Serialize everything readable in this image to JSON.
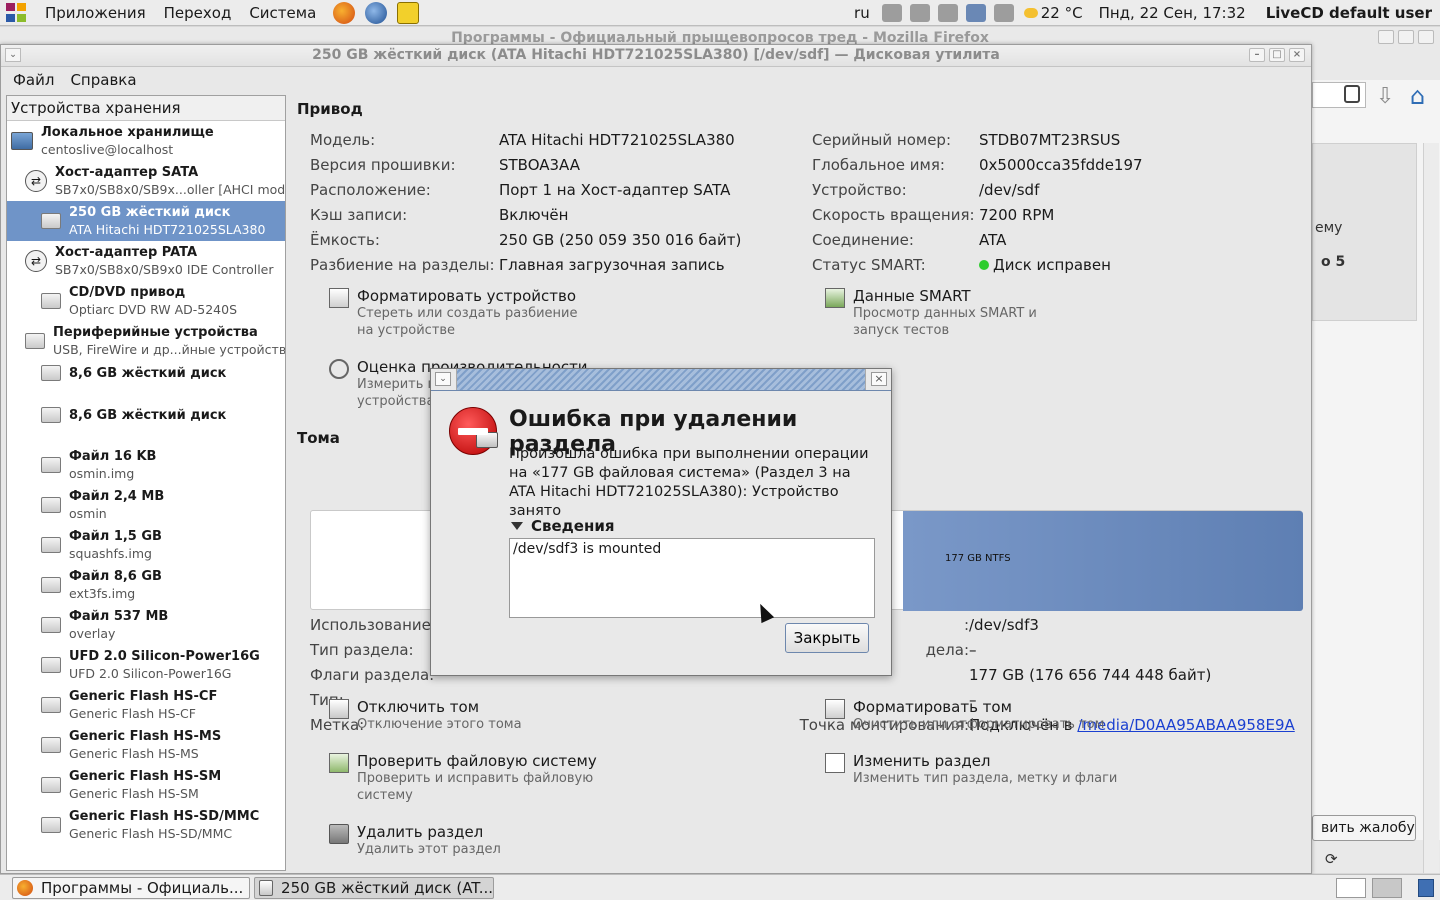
{
  "top_panel": {
    "menus": [
      "Приложения",
      "Переход",
      "Система"
    ],
    "lang": "ru",
    "weather": "22 °C",
    "datetime": "Пнд, 22 Сен, 17:32",
    "user": "LiveCD default user"
  },
  "firefox": {
    "title": "Программы - Официальный прыщевопросов тред - Mozilla Firefox",
    "partial_text1": "ему",
    "partial_text2": "о 5",
    "complaint_button": "вить жалобу"
  },
  "window": {
    "title": "250 GB жёсткий диск (ATA Hitachi HDT721025SLA380) [/dev/sdf] — Дисковая утилита",
    "menu": [
      "Файл",
      "Справка"
    ]
  },
  "sidebar": {
    "header": "Устройства хранения",
    "items": [
      {
        "title": "Локальное хранилище",
        "sub": "centoslive@localhost",
        "icon": "laptop-icon",
        "indent": 0
      },
      {
        "title": "Хост-адаптер SATA",
        "sub": "SB7x0/SB8x0/SB9x...oller [AHCI mode]",
        "icon": "host-adapter-icon",
        "indent": 1
      },
      {
        "title": "250 GB жёсткий диск",
        "sub": "ATA Hitachi HDT721025SLA380",
        "icon": "hard-disk-icon",
        "indent": 2,
        "selected": true
      },
      {
        "title": "Хост-адаптер PATA",
        "sub": "SB7x0/SB8x0/SB9x0 IDE Controller",
        "icon": "host-adapter-icon",
        "indent": 1
      },
      {
        "title": "CD/DVD привод",
        "sub": "Optiarc DVD RW AD-5240S",
        "icon": "optical-drive-icon",
        "indent": 2
      },
      {
        "title": "Периферийные устройства",
        "sub": "USB, FireWire и др...йные устройства",
        "icon": "usb-icon",
        "indent": 1
      },
      {
        "title": "8,6 GB жёсткий диск",
        "sub": "",
        "icon": "hard-disk-icon",
        "indent": 2
      },
      {
        "title": "8,6 GB жёсткий диск",
        "sub": "",
        "icon": "hard-disk-icon",
        "indent": 2
      },
      {
        "title": "Файл 16 KB",
        "sub": "osmin.img",
        "icon": "hard-disk-icon",
        "indent": 2
      },
      {
        "title": "Файл 2,4 MB",
        "sub": "osmin",
        "icon": "hard-disk-icon",
        "indent": 2
      },
      {
        "title": "Файл 1,5 GB",
        "sub": "squashfs.img",
        "icon": "hard-disk-icon",
        "indent": 2
      },
      {
        "title": "Файл 8,6 GB",
        "sub": "ext3fs.img",
        "icon": "hard-disk-icon",
        "indent": 2
      },
      {
        "title": "Файл 537 MB",
        "sub": "overlay",
        "icon": "hard-disk-icon",
        "indent": 2
      },
      {
        "title": "UFD 2.0 Silicon-Power16G",
        "sub": "UFD 2.0 Silicon-Power16G",
        "icon": "usb-disk-icon",
        "indent": 2
      },
      {
        "title": "Generic Flash HS-CF",
        "sub": "Generic Flash HS-CF",
        "icon": "usb-disk-icon",
        "indent": 2
      },
      {
        "title": "Generic Flash HS-MS",
        "sub": "Generic Flash HS-MS",
        "icon": "usb-disk-icon",
        "indent": 2
      },
      {
        "title": "Generic Flash HS-SM",
        "sub": "Generic Flash HS-SM",
        "icon": "usb-disk-icon",
        "indent": 2
      },
      {
        "title": "Generic Flash HS-SD/MMC",
        "sub": "Generic Flash HS-SD/MMC",
        "icon": "usb-disk-icon",
        "indent": 2
      }
    ]
  },
  "drive": {
    "section_title": "Привод",
    "left": [
      {
        "k": "Модель:",
        "v": "ATA Hitachi HDT721025SLA380"
      },
      {
        "k": "Версия прошивки:",
        "v": "STBOA3AA"
      },
      {
        "k": "Расположение:",
        "v": "Порт 1 на Хост-адаптер SATA"
      },
      {
        "k": "Кэш записи:",
        "v": "Включён"
      },
      {
        "k": "Ёмкость:",
        "v": "250 GB (250 059 350 016 байт)"
      },
      {
        "k": "Разбиение на разделы:",
        "v": "Главная загрузочная запись"
      }
    ],
    "right": [
      {
        "k": "Серийный номер:",
        "v": "STDB07MT23RSUS"
      },
      {
        "k": "Глобальное имя:",
        "v": "0x5000cca35fdde197"
      },
      {
        "k": "Устройство:",
        "v": "/dev/sdf"
      },
      {
        "k": "Скорость вращения:",
        "v": "7200 RPM"
      },
      {
        "k": "Соединение:",
        "v": "ATA"
      },
      {
        "k": "Статус SMART:",
        "v": "Диск исправен"
      }
    ],
    "actions": {
      "format_title": "Форматировать устройство",
      "format_desc": "Стереть или создать разбиение на устройстве",
      "smart_title": "Данные SMART",
      "smart_desc": "Просмотр данных SMART и запуск тестов",
      "bench_title": "Оценка производительности",
      "bench_desc1": "Измерить п",
      "bench_desc2": "устройства"
    }
  },
  "volumes": {
    "section_title": "Тома",
    "segment_label": "177 GB NTFS",
    "left_labels": [
      "Использование",
      "Тип раздела:",
      "Флаги раздела:",
      "Тип:",
      "Метка:"
    ],
    "right_rows": [
      {
        "k": ":",
        "v": "/dev/sdf3"
      },
      {
        "k": "дела:",
        "v": "–"
      },
      {
        "k": "",
        "v": "177 GB (176 656 744 448 байт)"
      },
      {
        "k": "",
        "v": "–"
      },
      {
        "k": "Точка монтирования:",
        "v": "Подключён в ",
        "link": "/media/D0AA95ABAA958E9A"
      }
    ],
    "actions": {
      "unmount_title": "Отключить том",
      "unmount_desc": "Отключение этого тома",
      "fmtvol_title": "Форматировать том",
      "fmtvol_desc": "Очистить или отформатировать том",
      "check_title": "Проверить файловую систему",
      "check_desc": "Проверить и исправить файловую систему",
      "edit_title": "Изменить раздел",
      "edit_desc": "Изменить тип раздела, метку и флаги",
      "delete_title": "Удалить раздел",
      "delete_desc": "Удалить этот раздел"
    }
  },
  "dialog": {
    "heading": "Ошибка при удалении раздела",
    "message": "Произошла ошибка при выполнении операции на «177 GB файловая система» (Раздел 3 на ATA Hitachi HDT721025SLA380): Устройство занято",
    "details_label": "Сведения",
    "details_text": "/dev/sdf3 is mounted",
    "close_button": "Закрыть"
  },
  "taskbar": {
    "tasks": [
      "Программы - Официаль...",
      "250 GB жёсткий диск (AT..."
    ]
  }
}
